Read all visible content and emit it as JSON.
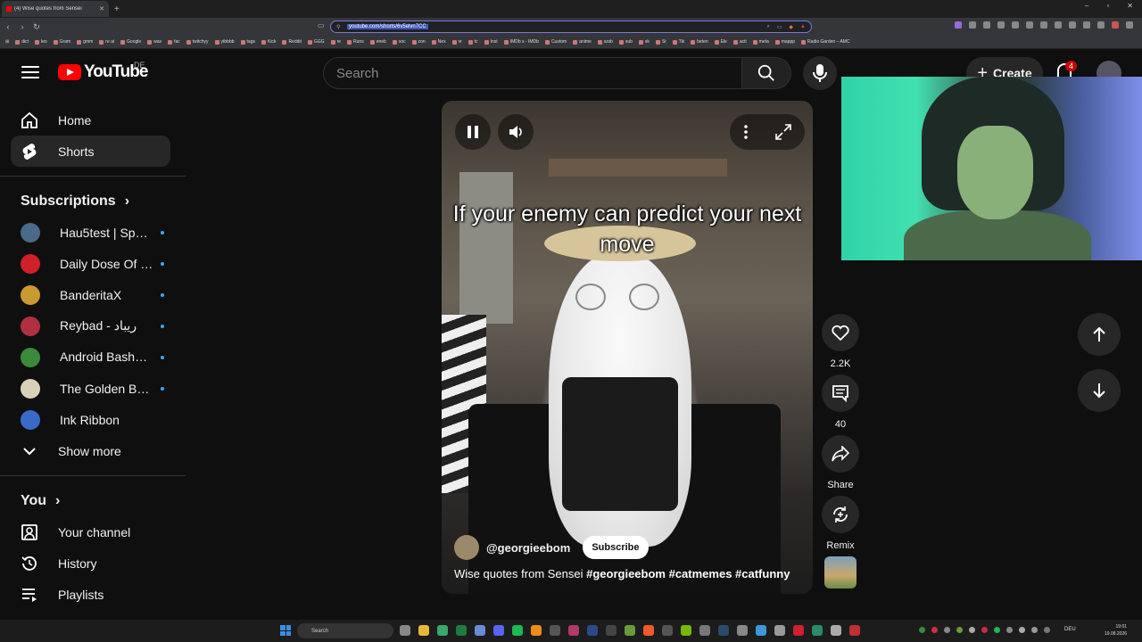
{
  "browser": {
    "tab_title": "(4) Wise quotes from Sensei",
    "url": "youtube.com/shorts/6v5elvn7CC",
    "bookmarks": [
      "dict",
      "leo",
      "Gram",
      "gmm",
      "re ai",
      "Google",
      "was",
      "fac",
      "twitchyy",
      "ytbbbb",
      "tags",
      "Kick",
      "Reddit",
      "GGG",
      "re",
      "Runs",
      "eneb",
      "soc",
      "zon",
      "Nex",
      "vr",
      "tc",
      "Inst",
      "IMDb s - IMDb",
      "Custom",
      "anime",
      "arab",
      "sub",
      "sk",
      "St",
      "Tik",
      "beten",
      "Ele",
      "acti",
      "meta",
      "mappp",
      "Radio Garden – AMC"
    ]
  },
  "header": {
    "logo_text": "YouTube",
    "region": "DE",
    "search_placeholder": "Search",
    "create_label": "Create",
    "notif_count": "4"
  },
  "sidebar": {
    "main": [
      {
        "label": "Home",
        "icon": "home-icon"
      },
      {
        "label": "Shorts",
        "icon": "shorts-icon",
        "active": true
      }
    ],
    "subscriptions_heading": "Subscriptions",
    "subscriptions": [
      {
        "label": "Hau5test | Speed...",
        "color": "#4a6a8a"
      },
      {
        "label": "Daily Dose Of Int...",
        "color": "#d0202a"
      },
      {
        "label": "BanderitaX",
        "color": "#c89a30"
      },
      {
        "label": "Reybad - ريباد",
        "color": "#b03040"
      },
      {
        "label": "Android Basha | ا...",
        "color": "#3a8a3a"
      },
      {
        "label": "The Golden Bala...",
        "color": "#d8d0b8"
      },
      {
        "label": "Ink Ribbon",
        "color": "#3a6ac8"
      }
    ],
    "show_more": "Show more",
    "you_heading": "You",
    "you_items": [
      {
        "label": "Your channel",
        "icon": "channel-icon"
      },
      {
        "label": "History",
        "icon": "history-icon"
      },
      {
        "label": "Playlists",
        "icon": "playlists-icon"
      }
    ]
  },
  "video": {
    "caption": "If your enemy can predict your next move",
    "channel": "@georgieebom",
    "subscribe_label": "Subscribe",
    "title_plain": "Wise quotes from Sensei ",
    "title_tags": "#georgieebom #catmemes #catfunny"
  },
  "actions": {
    "like_count": "2.2K",
    "comment_count": "40",
    "share_label": "Share",
    "remix_label": "Remix"
  },
  "taskbar": {
    "search_label": "Search",
    "lang": "DEU",
    "time": "19:01",
    "date": "19.08.2026"
  }
}
